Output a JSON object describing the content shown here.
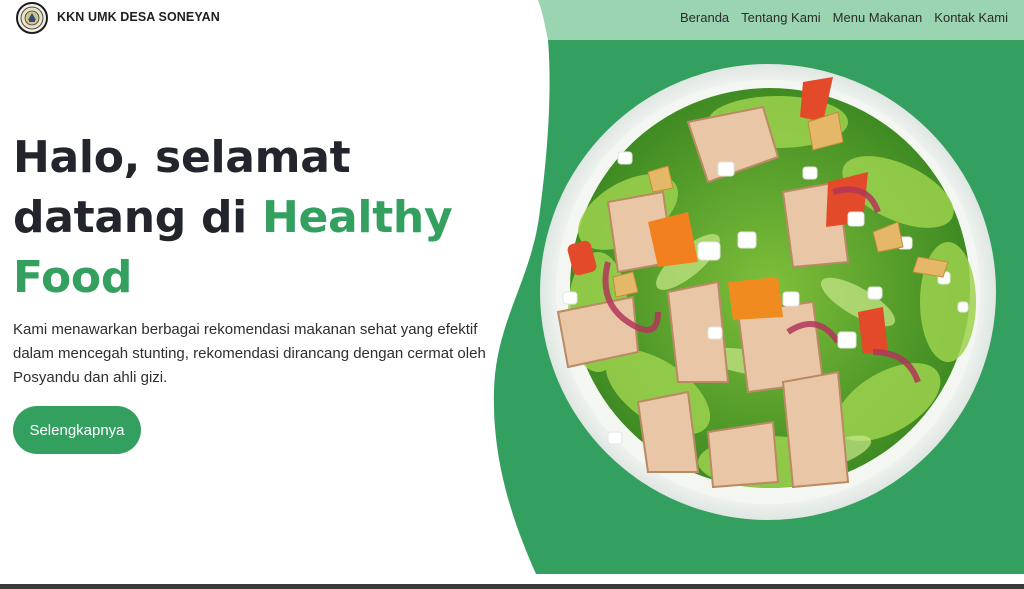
{
  "brand": {
    "name": "KKN UMK DESA SONEYAN"
  },
  "nav": {
    "items": [
      {
        "label": "Beranda"
      },
      {
        "label": "Tentang Kami"
      },
      {
        "label": "Menu Makanan"
      },
      {
        "label": "Kontak Kami"
      }
    ]
  },
  "hero": {
    "title_line1": "Halo, selamat",
    "title_line2_prefix": "datang di ",
    "title_line2_accent": "Healthy",
    "title_line3_accent": "Food",
    "description": "Kami menawarkan berbagai rekomendasi makanan sehat yang efektif dalam mencegah stunting, rekomendasi dirancang dengan cermat oleh Posyandu dan ahli gizi.",
    "cta_label": "Selengkapnya"
  },
  "colors": {
    "accent": "#33a05f",
    "nav_green": "#9bd4b0",
    "hero_green": "#33a05f",
    "text_dark": "#22252b"
  },
  "icons": {
    "logo": "university-seal-icon"
  }
}
